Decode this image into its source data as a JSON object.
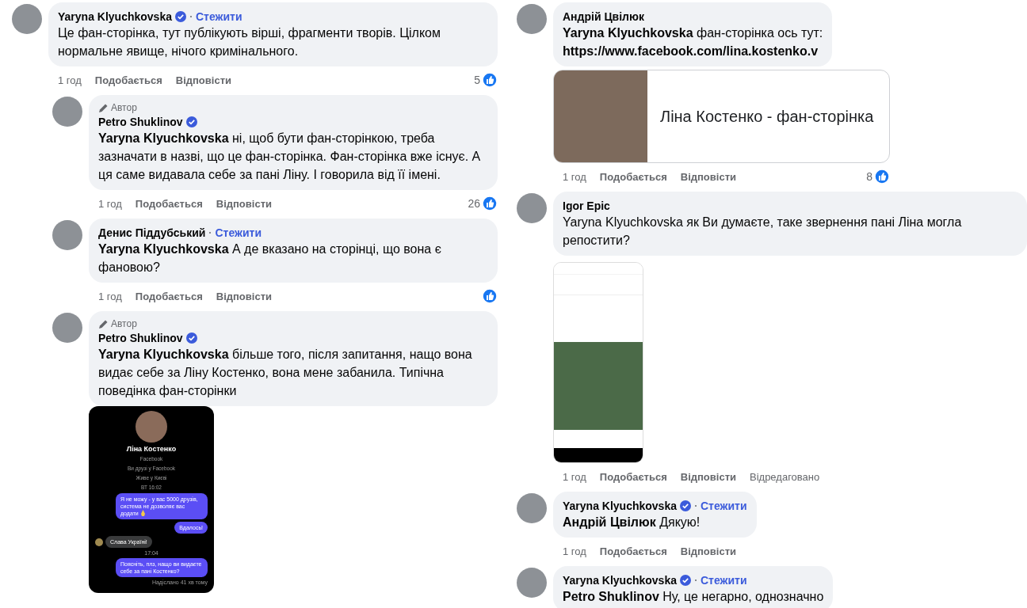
{
  "columns": [
    {
      "comments": [
        {
          "author": "Yaryna Klyuchkovska",
          "verified": true,
          "follow": "Стежити",
          "text": "Це фан-сторінка, тут публікують вірші, фрагменти творів. Цілком нормальне явище, нічого кримінального.",
          "time": "1 год",
          "like": "Подобається",
          "reply": "Відповісти",
          "reacted": true,
          "reactions": "5",
          "children": [
            {
              "badge": "Автор",
              "author": "Petro Shuklinov",
              "verified": true,
              "text": "**Yaryna Klyuchkovska** ні, щоб бути фан-сторінкою, треба зазначати в назві, що це фан-сторінка. Фан-сторінка вже існує. А ця саме видавала себе за пані Ліну. І говорила від її імені.",
              "time": "1 год",
              "like": "Подобається",
              "reply": "Відповісти",
              "reacted": true,
              "reactions": "26"
            },
            {
              "author": "Денис Піддубський",
              "verified": false,
              "follow": "Стежити",
              "text": "**Yaryna Klyuchkovska** А де вказано на сторінці, що вона є фановою?",
              "time": "1 год",
              "like": "Подобається",
              "reply": "Відповісти",
              "reacted": true
            },
            {
              "badge": "Автор",
              "author": "Petro Shuklinov",
              "verified": true,
              "text": "**Yaryna Klyuchkovska** більше того, після запитання, нащо вона видає себе за Ліну Костенко, вона мене забанила. Типічна поведінка фан-сторінки",
              "attachment": {
                "kind": "chat_screenshot",
                "name": "Ліна Костенко",
                "info": [
                  "Facebook",
                  "Ви друзі у Facebook",
                  "Живе у Києві",
                  "ВТ 16:02"
                ],
                "messages": [
                  {
                    "kind": "outgoing",
                    "text": "Я не можу - у вас 5000 друзів, система не дозволяє вас додати",
                    "pray_icon": true
                  },
                  {
                    "kind": "outgoing",
                    "text": "Вдалось!",
                    "pray_icon": false
                  },
                  {
                    "kind": "incoming",
                    "text": "Слава Україні!"
                  },
                  {
                    "kind": "time",
                    "text": "17:04"
                  },
                  {
                    "kind": "outgoing",
                    "text": "Поясніть, плз, нащо ви видаєте себе за пані Костенко?",
                    "pray_icon": false
                  },
                  {
                    "kind": "status",
                    "text": "Надіслано 41 хв тому"
                  }
                ]
              }
            }
          ]
        }
      ]
    },
    {
      "comments": [
        {
          "author": "Андрій Цвілюк",
          "verified": false,
          "text": "**Yaryna Klyuchkovska** фан-сторінка ось тут:",
          "link": "https://www.facebook.com/lina.kostenko.v",
          "attachment": {
            "kind": "link_preview",
            "title": "Ліна Костенко - фан-сторінка"
          },
          "time": "1 год",
          "like": "Подобається",
          "reply": "Відповісти",
          "reacted": true,
          "reactions": "8"
        },
        {
          "author": "Igor Epic",
          "verified": false,
          "text": "Yaryna Klyuchkovska як Ви думаєте, таке звернення пані Ліна могла репостити?",
          "attachment": {
            "kind": "post_screenshot"
          },
          "time": "1 год",
          "like": "Подобається",
          "reply": "Відповісти",
          "edited": "Відредаговано",
          "reacted": false
        },
        {
          "author": "Yaryna Klyuchkovska",
          "verified": true,
          "follow": "Стежити",
          "text": "**Андрій Цвілюк** Дякую!",
          "time": "1 год",
          "like": "Подобається",
          "reply": "Відповісти",
          "reacted": false
        },
        {
          "author": "Yaryna Klyuchkovska",
          "verified": true,
          "follow": "Стежити",
          "text": "**Petro Shuklinov** Ну, це негарно, однозначно"
        }
      ]
    }
  ]
}
